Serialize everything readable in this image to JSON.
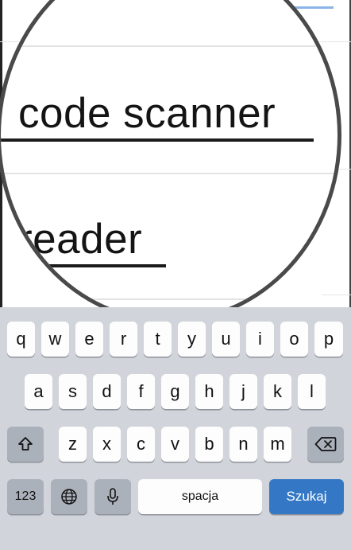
{
  "magnifier": {
    "line1": "code scanner",
    "line2": "reader"
  },
  "keyboard": {
    "row1": [
      "q",
      "w",
      "e",
      "r",
      "t",
      "y",
      "u",
      "i",
      "o",
      "p"
    ],
    "row2": [
      "a",
      "s",
      "d",
      "f",
      "g",
      "h",
      "j",
      "k",
      "l"
    ],
    "row3": [
      "z",
      "x",
      "c",
      "v",
      "b",
      "n",
      "m"
    ],
    "numbers_label": "123",
    "space_label": "spacja",
    "search_label": "Szukaj",
    "shift_icon": "shift-icon",
    "backspace_icon": "backspace-icon",
    "globe_icon": "globe-icon",
    "mic_icon": "microphone-icon"
  },
  "colors": {
    "keyboard_bg": "#d1d4da",
    "key_bg": "#fdfdfd",
    "func_key_bg": "#abb1bb",
    "search_key_bg": "#3478c5"
  }
}
